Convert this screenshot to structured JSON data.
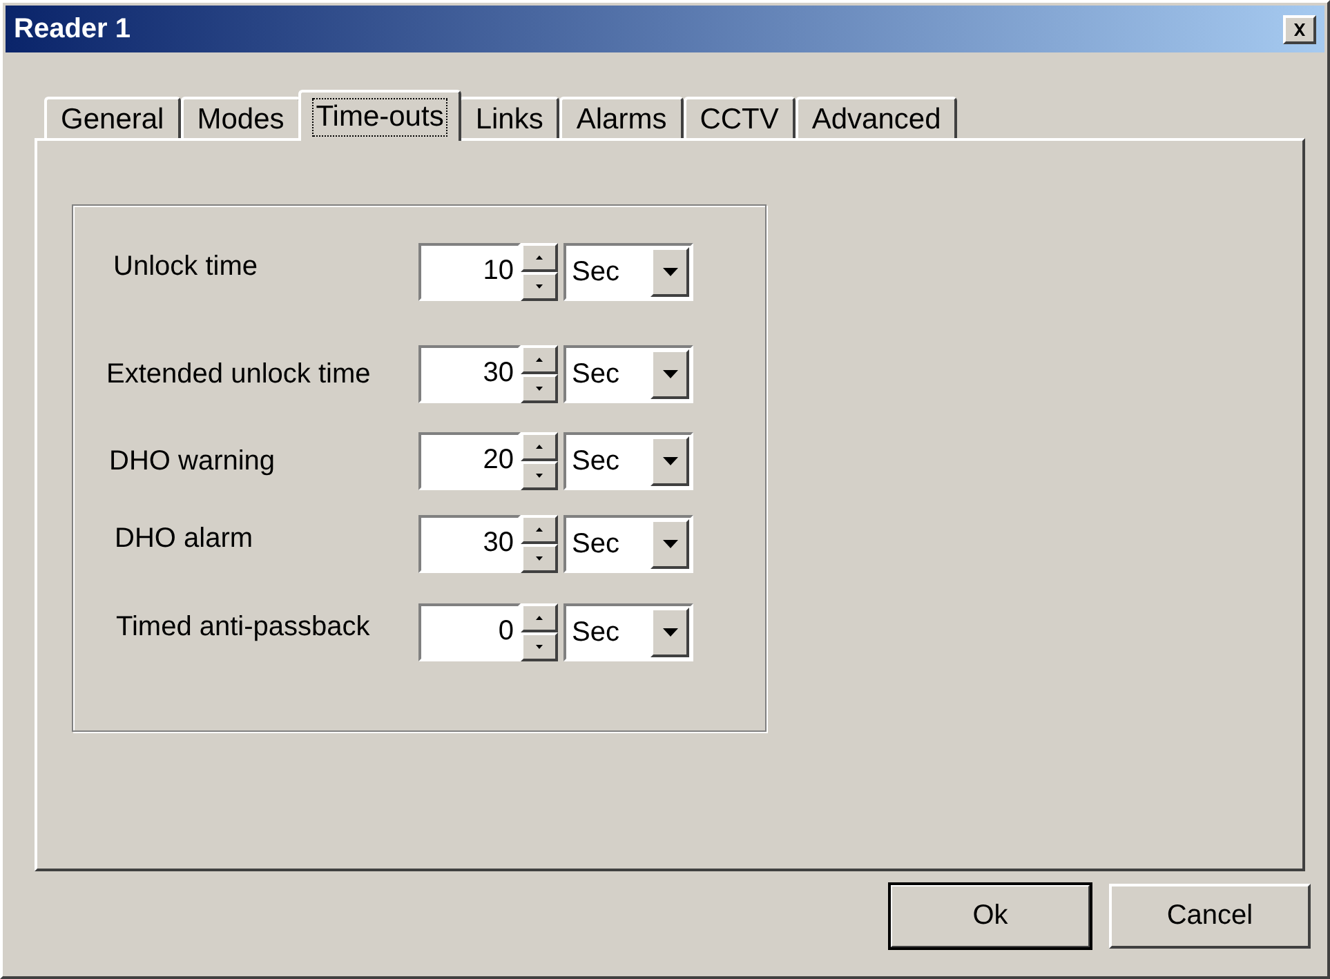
{
  "window": {
    "title": "Reader 1"
  },
  "tabs": [
    {
      "label": "General",
      "selected": false
    },
    {
      "label": "Modes",
      "selected": false
    },
    {
      "label": "Time-outs",
      "selected": true
    },
    {
      "label": "Links",
      "selected": false
    },
    {
      "label": "Alarms",
      "selected": false
    },
    {
      "label": "CCTV",
      "selected": false
    },
    {
      "label": "Advanced",
      "selected": false
    }
  ],
  "timeouts": [
    {
      "label": "Unlock time",
      "value": "10",
      "unit": "Sec"
    },
    {
      "label": "Extended unlock time",
      "value": "30",
      "unit": "Sec"
    },
    {
      "label": "DHO warning",
      "value": "20",
      "unit": "Sec"
    },
    {
      "label": "DHO alarm",
      "value": "30",
      "unit": "Sec"
    },
    {
      "label": "Timed anti-passback",
      "value": "0",
      "unit": "Sec"
    }
  ],
  "buttons": [
    {
      "label": "Ok",
      "default": true
    },
    {
      "label": "Cancel",
      "default": false
    }
  ]
}
